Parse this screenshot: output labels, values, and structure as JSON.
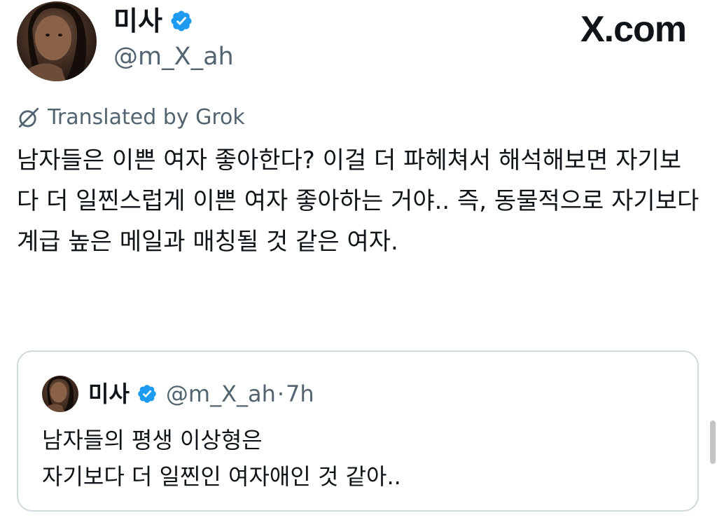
{
  "colors": {
    "text": "#0f1419",
    "secondary": "#536471",
    "verified": "#1d9bf0",
    "border": "#cfd9de"
  },
  "header": {
    "display_name": "미사",
    "handle": "@m_X_ah",
    "brand": "X.com",
    "verified_icon": "verified-badge-icon"
  },
  "translation": {
    "icon": "translate-icon",
    "label": "Translated by Grok"
  },
  "tweet": {
    "text": "남자들은 이쁜 여자 좋아한다? 이걸 더 파헤쳐서 해석해보면 자기보다 더 일찐스럽게 이쁜 여자 좋아하는 거야.. 즉, 동물적으로 자기보다 계급 높은 메일과 매칭될 것 같은 여자."
  },
  "quote": {
    "display_name": "미사",
    "handle": "@m_X_ah",
    "separator": "·",
    "time": "7h",
    "lines": [
      "남자들의 평생 이상형은",
      "자기보다 더 일찐인 여자애인 것 같아.."
    ]
  }
}
